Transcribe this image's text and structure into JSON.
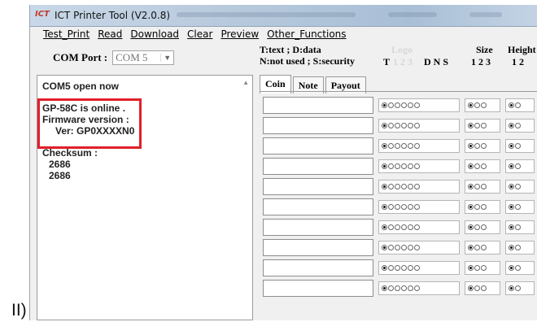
{
  "side_label": "II)",
  "window": {
    "title": "ICT Printer Tool (V2.0.8)",
    "logo_text": "ICT"
  },
  "menu": [
    "Test_Print",
    "Read",
    "Download",
    "Clear",
    "Preview",
    "Other_Functions"
  ],
  "com_port": {
    "label": "COM Port :",
    "value": "COM 5"
  },
  "log": {
    "status": "COM5  open now",
    "online": "GP-58C is online .",
    "firmware_label": "Firmware version :",
    "version": "Ver: GP0XXXXN0",
    "checksum_label": "Checksum :",
    "checksum_values": [
      "2686",
      "2686"
    ]
  },
  "legend": {
    "line1": "T:text ; D:data",
    "line2": "N:not used ; S:security"
  },
  "columns": {
    "logo": "Logo",
    "t_header": "T",
    "logo_digits": "1 2 3",
    "dns": "D N S",
    "size": "Size",
    "size_opts": "1 2 3",
    "height": "Height",
    "height_opts": "1 2"
  },
  "tabs": [
    "Coin",
    "Note",
    "Payout"
  ],
  "row_count": 10,
  "colors": {
    "highlight": "#e0202a",
    "title_gradient": "#b7c9dc"
  },
  "icons": [
    "printer-logo-icon",
    "chevron-down-icon",
    "scroll-up-arrow-icon",
    "radio-button-icon"
  ]
}
